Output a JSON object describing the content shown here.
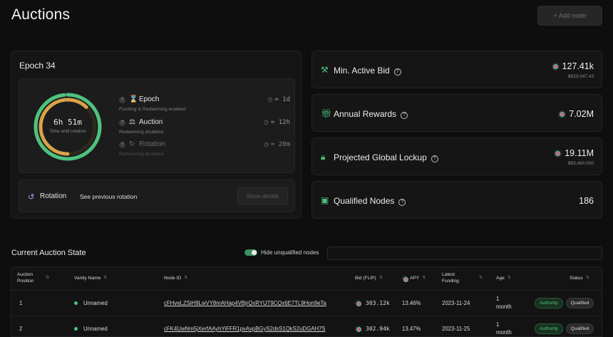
{
  "page": {
    "title": "Auctions",
    "add_node_label": "+ Add node"
  },
  "epoch": {
    "title": "Epoch 34",
    "ring_time": "6h 51m",
    "ring_subtitle": "Time until rotation",
    "ring_progress": 0.62,
    "phases": [
      {
        "icon": "hourglass-icon",
        "name": "Epoch",
        "desc": "Funding & Redeeming enabled",
        "duration": "≈ 1d"
      },
      {
        "icon": "gavel-icon",
        "name": "Auction",
        "desc": "Redeeming disabled",
        "duration": "≈ 12h"
      },
      {
        "icon": "rotate-icon",
        "name": "Rotation",
        "desc": "Redeeming disabled",
        "duration": "≈ 20m"
      }
    ],
    "rotation_label": "Rotation",
    "see_previous_label": "See previous rotation",
    "show_details_label": "Show details"
  },
  "stats": {
    "min_active_bid": {
      "label": "Min. Active Bid",
      "value": "127.41k",
      "sub": "$623,047.43"
    },
    "annual_rewards": {
      "label": "Annual Rewards",
      "value": "7.02M"
    },
    "projected_lockup": {
      "label": "Projected Global Lockup",
      "value": "19.11M",
      "sub": "$93,460,000"
    },
    "qualified_nodes": {
      "label": "Qualified Nodes",
      "value": "186"
    }
  },
  "auction_state": {
    "title": "Current Auction State",
    "toggle_label": "Hide unqualified nodes",
    "search_placeholder": ""
  },
  "table": {
    "headers": {
      "position": "Auction Position",
      "vanity": "Vanity Name",
      "node_id": "Node ID",
      "bid": "Bid (FLIP)",
      "apy": "APY",
      "latest_funding": "Latest Funding",
      "age": "Age",
      "status": "Status"
    },
    "rows": [
      {
        "position": "1",
        "vanity": "Unnamed",
        "node_id": "cFHveLZSiH9LwVY8mAHap4VBjrQxRYUT9CQx6E7TL9Hon9eTa",
        "bid": "303.12k",
        "apy": "13.46%",
        "funding": "2023-11-24",
        "age_num": "1",
        "age_unit": "month",
        "badge1": "Authority",
        "badge2": "Qualified"
      },
      {
        "position": "2",
        "vanity": "Unnamed",
        "node_id": "cFK4UwNm5jXerfAAyhYiFFR1pvAxpBGyS2dsS1QkS2uDGAH7S",
        "bid": "302.94k",
        "apy": "13.47%",
        "funding": "2023-11-25",
        "age_num": "1",
        "age_unit": "month",
        "badge1": "Authority",
        "badge2": "Qualified"
      }
    ]
  },
  "colors": {
    "accent_green": "#4ec27e",
    "ring_orange": "#d9a24a",
    "background": "#0e0e0e"
  }
}
